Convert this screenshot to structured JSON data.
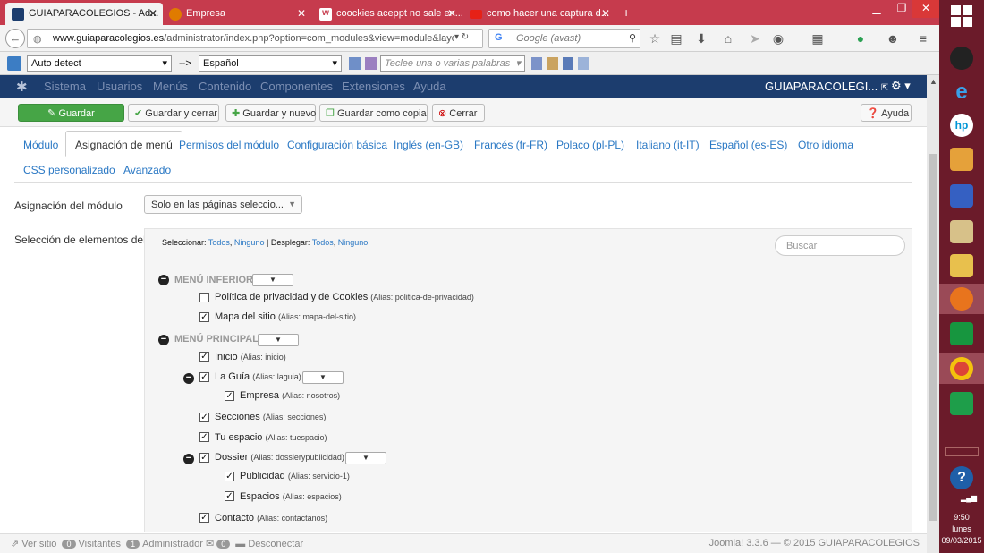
{
  "browser": {
    "tabs": [
      {
        "label": "GUIAPARACOLEGIOS - Ad..."
      },
      {
        "label": "Empresa"
      },
      {
        "label": "coockies aceppt no sale en..."
      },
      {
        "label": "como hacer una captura d..."
      }
    ],
    "new_tab": "+",
    "url_host": "www.guiaparacolegios.es",
    "url_path": "/administrator/index.php?option=com_modules&view=module&layout=edit&id=",
    "search_placeholder": "Google (avast)",
    "search_engine": "G"
  },
  "translator": {
    "from": "Auto detect",
    "arrow": "-->",
    "to": "Español",
    "input_placeholder": "Teclee una o varias palabras"
  },
  "joomla": {
    "nav": [
      "Sistema",
      "Usuarios",
      "Menús",
      "Contenido",
      "Componentes",
      "Extensiones",
      "Ayuda"
    ],
    "site_name": "GUIAPARACOLEGI...",
    "site_icon": "external-link-icon",
    "settings_icon": "gear-icon",
    "toolbar": {
      "save": "Guardar",
      "save_close": "Guardar y cerrar",
      "save_new": "Guardar y nuevo",
      "save_copy": "Guardar como copia",
      "close": "Cerrar",
      "help": "Ayuda"
    },
    "tabs": [
      "Módulo",
      "Asignación de menú",
      "Permisos del módulo",
      "Configuración básica",
      "Inglés (en-GB)",
      "Francés (fr-FR)",
      "Polaco (pl-PL)",
      "Italiano (it-IT)",
      "Español (es-ES)",
      "Otro idioma",
      "CSS personalizado",
      "Avanzado"
    ],
    "assign_label": "Asignación del módulo",
    "assign_value": "Solo en las páginas seleccio...",
    "selection_label": "Selección de elementos del menú:",
    "select_label": "Seleccionar:",
    "select_all": "Todos",
    "select_none": "Ninguno",
    "sep": "|",
    "expand_label": "Desplegar:",
    "expand_all": "Todos",
    "expand_none": "Ninguno",
    "search_placeholder": "Buscar",
    "groups": [
      {
        "title": "MENÚ INFERIOR",
        "items": [
          {
            "label": "Política de privacidad y de Cookies",
            "alias": "(Alias: politica-de-privacidad)",
            "checked": false
          },
          {
            "label": "Mapa del sitio",
            "alias": "(Alias: mapa-del-sitio)",
            "checked": true
          }
        ]
      },
      {
        "title": "MENÚ PRINCIPAL",
        "items": [
          {
            "label": "Inicio",
            "alias": "(Alias: inicio)",
            "checked": true
          },
          {
            "label": "La Guía",
            "alias": "(Alias: laguia)",
            "checked": true
          },
          {
            "label": "Empresa",
            "alias": "(Alias: nosotros)",
            "checked": true
          },
          {
            "label": "Secciones",
            "alias": "(Alias: secciones)",
            "checked": true
          },
          {
            "label": "Tu espacio",
            "alias": "(Alias: tuespacio)",
            "checked": true
          },
          {
            "label": "Dossier",
            "alias": "(Alias: dossierypublicidad)",
            "checked": true
          },
          {
            "label": "Publicidad",
            "alias": "(Alias: servicio-1)",
            "checked": true
          },
          {
            "label": "Espacios",
            "alias": "(Alias: espacios)",
            "checked": true
          },
          {
            "label": "Contacto",
            "alias": "(Alias: contactanos)",
            "checked": true
          }
        ]
      }
    ],
    "status": {
      "view_site": "Ver sitio",
      "visitors_count": "0",
      "visitors": "Visitantes",
      "admin_count": "1",
      "admin": "Administrador",
      "msg_count": "0",
      "logout": "Desconectar",
      "footer": "Joomla! 3.3.6  —  © 2015 GUIAPARACOLEGIOS"
    }
  },
  "taskbar": {
    "time": "9:50",
    "day": "lunes",
    "date": "09/03/2015"
  },
  "colors": {
    "tabbar": "#c63b4d",
    "joomla_nav": "#1c3d6e",
    "save_green": "#46a546",
    "link": "#2a78c4",
    "taskbar": "#6b1b2a"
  }
}
